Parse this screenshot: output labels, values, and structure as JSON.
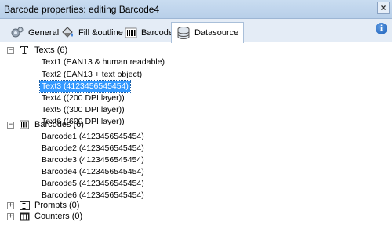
{
  "window": {
    "title": "Barcode properties: editing Barcode4",
    "close_glyph": "×",
    "info_glyph": "i"
  },
  "tabs": [
    {
      "label": "General",
      "icon": "gear-icon"
    },
    {
      "label": "Fill &outline",
      "icon": "paint-bucket-icon"
    },
    {
      "label": "Barcode",
      "icon": "barcode-icon"
    },
    {
      "label": "Datasource",
      "icon": "database-icon",
      "active": true
    }
  ],
  "tree": {
    "texts": {
      "label": "Texts (6)",
      "expander": "−",
      "items": [
        "Text1 (EAN13 & human readable)",
        "Text2 (EAN13 + text object)",
        "Text3 (4123456545454)",
        "Text4 ((200 DPI layer))",
        "Text5 ((300 DPI layer))",
        "Text6 ((600 DPI layer))"
      ],
      "selected_index": 2
    },
    "barcodes": {
      "label": "Barcodes (6)",
      "expander": "−",
      "items": [
        "Barcode1 (4123456545454)",
        "Barcode2 (4123456545454)",
        "Barcode3 (4123456545454)",
        "Barcode4 (4123456545454)",
        "Barcode5 (4123456545454)",
        "Barcode6 (4123456545454)"
      ]
    },
    "prompts": {
      "label": "Prompts (0)",
      "expander": "+"
    },
    "counters": {
      "label": "Counters (0)",
      "expander": "+"
    }
  },
  "colors": {
    "selection": "#3399ff",
    "titlebar": "#c9dcf0",
    "tabbar": "#e4ecf6"
  }
}
